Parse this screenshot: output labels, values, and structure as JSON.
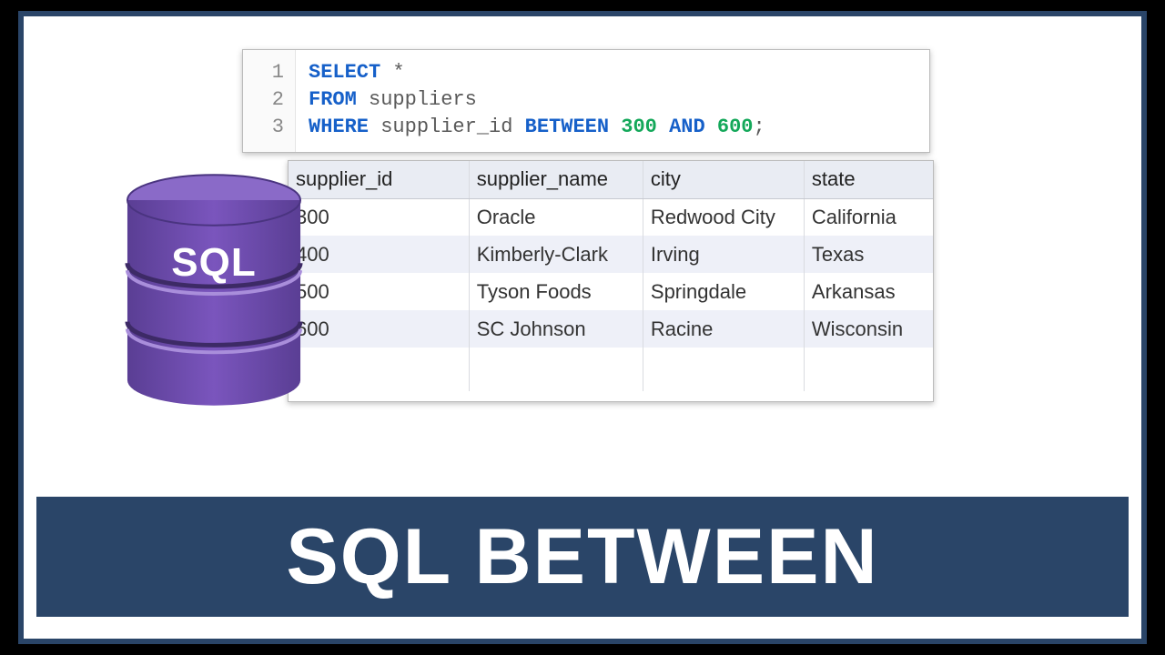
{
  "title": "SQL BETWEEN",
  "db_label": "SQL",
  "code": {
    "lines": [
      "1",
      "2",
      "3"
    ],
    "select_kw": "SELECT",
    "select_star": "*",
    "from_kw": "FROM",
    "from_table": "suppliers",
    "where_kw": "WHERE",
    "where_col": "supplier_id",
    "between_kw": "BETWEEN",
    "val1": "300",
    "and_kw": "AND",
    "val2": "600",
    "terminator": ";"
  },
  "table": {
    "headers": {
      "supplier_id": "supplier_id",
      "supplier_name": "supplier_name",
      "city": "city",
      "state": "state"
    },
    "rows": [
      {
        "supplier_id": "300",
        "supplier_name": "Oracle",
        "city": "Redwood City",
        "state": "California"
      },
      {
        "supplier_id": "400",
        "supplier_name": "Kimberly-Clark",
        "city": "Irving",
        "state": "Texas"
      },
      {
        "supplier_id": "500",
        "supplier_name": "Tyson Foods",
        "city": "Springdale",
        "state": "Arkansas"
      },
      {
        "supplier_id": "600",
        "supplier_name": "SC Johnson",
        "city": "Racine",
        "state": "Wisconsin"
      }
    ]
  },
  "colors": {
    "brand_navy": "#2a4568",
    "db_purple": "#6b46a8",
    "keyword_blue": "#1660c9",
    "number_green": "#14a85a"
  }
}
